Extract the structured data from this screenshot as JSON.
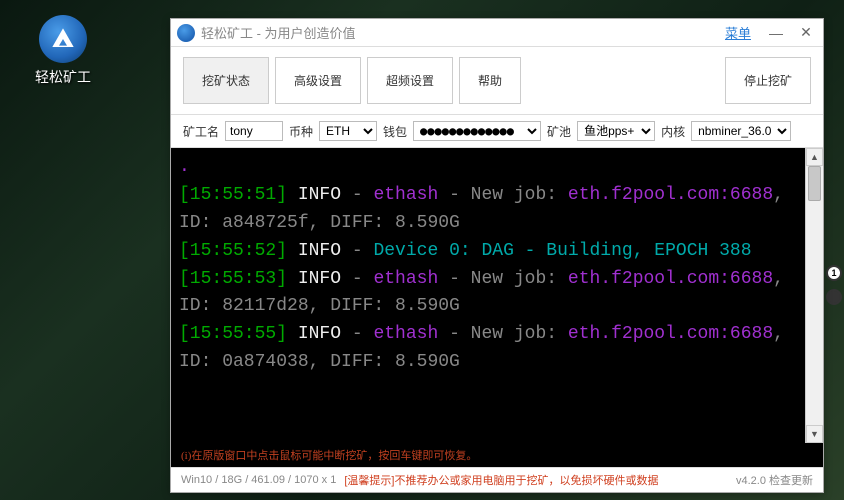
{
  "desktop": {
    "icon_label": "轻松矿工"
  },
  "titlebar": {
    "title": "轻松矿工 - 为用户创造价值",
    "menu": "菜单"
  },
  "toolbar": {
    "mining_status": "挖矿状态",
    "advanced": "高级设置",
    "overclock": "超频设置",
    "help": "帮助",
    "stop_mining": "停止挖矿"
  },
  "config": {
    "miner_label": "矿工名",
    "miner_value": "tony",
    "coin_label": "币种",
    "coin_value": "ETH",
    "wallet_label": "钱包",
    "wallet_value": "●●●●●●●●●●●●●",
    "pool_label": "矿池",
    "pool_value": "鱼池pps+",
    "kernel_label": "内核",
    "kernel_value": "nbminer_36.0"
  },
  "terminal": {
    "lines": [
      {
        "ts": "[15:55:51]",
        "info": " INFO ",
        "dash": "- ",
        "p1": "ethash",
        "p2": " - New job: ",
        "p3": "eth.f2pool.com:6688",
        "p4": ", ID: a848725f, DIFF: ",
        "p5": "8.590G"
      },
      {
        "ts": "[15:55:52]",
        "info": " INFO ",
        "dash": "- ",
        "dev": "Device 0: DAG - Building, EPOCH 388"
      },
      {
        "ts": "[15:55:53]",
        "info": " INFO ",
        "dash": "- ",
        "p1": "ethash",
        "p2": " - New job: ",
        "p3": "eth.f2pool.com:6688",
        "p4": ", ID: 82117d28, DIFF: ",
        "p5": "8.590G"
      },
      {
        "ts": "[15:55:55]",
        "info": " INFO ",
        "dash": "- ",
        "p1": "ethash",
        "p2": " - New job: ",
        "p3": "eth.f2pool.com:6688",
        "p4": ", ID: 0a874038, DIFF: ",
        "p5": "8.590G"
      }
    ],
    "warning": "(i)在原版窗口中点击鼠标可能中断挖矿，按回车键即可恢复。"
  },
  "statusbar": {
    "sys": "Win10  /  18G / 461.09  / 1070 x 1",
    "tip": "[温馨提示]不推荐办公或家用电脑用于挖矿，以免损坏硬件或数据",
    "version": "v4.2.0 检查更新"
  }
}
